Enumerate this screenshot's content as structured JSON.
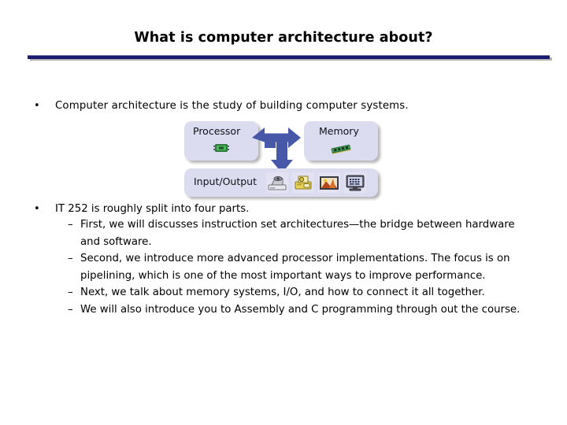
{
  "slide": {
    "title": "What is computer architecture about?",
    "accent_color": "#1a1a6e",
    "background_color": "#ffffff",
    "text_color": "#000000"
  },
  "bullets": [
    {
      "level": 1,
      "marker": "•",
      "text": "Computer architecture is the study of building computer systems."
    },
    {
      "level": 1,
      "marker": "•",
      "text": "IT 252 is roughly split into four parts."
    },
    {
      "level": 2,
      "marker": "–",
      "text": "First, we will discusses instruction set architectures—the bridge between hardware and software."
    },
    {
      "level": 2,
      "marker": "–",
      "text": "Second, we introduce more advanced processor implementations. The focus is on pipelining, which is one of the most important ways to improve performance."
    },
    {
      "level": 2,
      "marker": "–",
      "text": "Next, we talk about memory systems, I/O, and how to connect it all together."
    },
    {
      "level": 2,
      "marker": "–",
      "text": "We will also introduce you to Assembly and C programming through out the course."
    }
  ],
  "diagram": {
    "box_fill_color": "#dcdcf0",
    "arrow_color": "#4858a8",
    "processor": {
      "label": "Processor",
      "icon": "cpu-chip-icon"
    },
    "memory": {
      "label": "Memory",
      "icon": "memory-module-icon"
    },
    "io": {
      "label": "Input/Output",
      "icons": [
        "scanner-icon",
        "printer-icon",
        "picture-frame-icon",
        "monitor-icon"
      ]
    },
    "arrow": {
      "name": "tri-directional-arrow",
      "directions": [
        "left",
        "right",
        "down"
      ]
    }
  }
}
